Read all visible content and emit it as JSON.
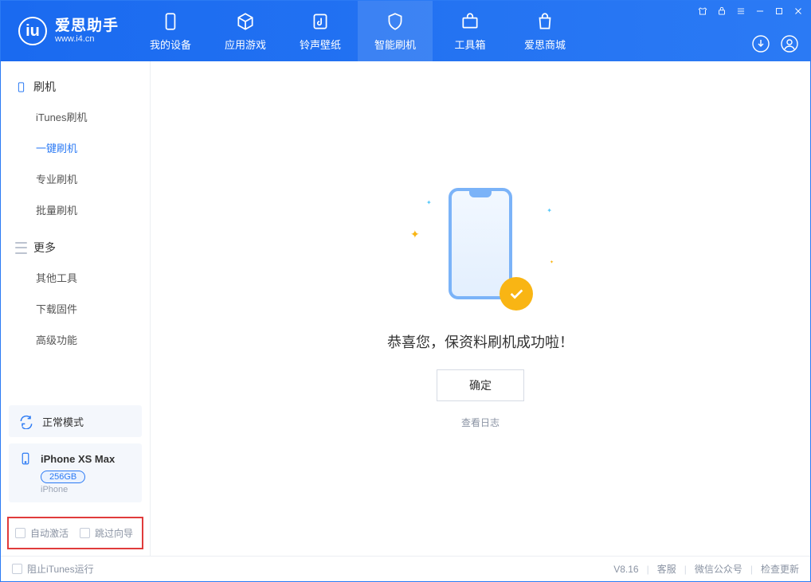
{
  "app": {
    "title": "爱思助手",
    "subtitle": "www.i4.cn"
  },
  "nav": {
    "items": [
      {
        "label": "我的设备"
      },
      {
        "label": "应用游戏"
      },
      {
        "label": "铃声壁纸"
      },
      {
        "label": "智能刷机"
      },
      {
        "label": "工具箱"
      },
      {
        "label": "爱思商城"
      }
    ]
  },
  "sidebar": {
    "group_flash": "刷机",
    "items_flash": [
      {
        "label": "iTunes刷机"
      },
      {
        "label": "一键刷机"
      },
      {
        "label": "专业刷机"
      },
      {
        "label": "批量刷机"
      }
    ],
    "group_more": "更多",
    "items_more": [
      {
        "label": "其他工具"
      },
      {
        "label": "下载固件"
      },
      {
        "label": "高级功能"
      }
    ]
  },
  "device": {
    "mode": "正常模式",
    "name": "iPhone XS Max",
    "storage": "256GB",
    "type": "iPhone"
  },
  "options": {
    "auto_activate": "自动激活",
    "skip_guide": "跳过向导"
  },
  "main": {
    "success_title": "恭喜您，保资料刷机成功啦！",
    "ok": "确定",
    "view_log": "查看日志"
  },
  "status": {
    "block_itunes": "阻止iTunes运行",
    "version": "V8.16",
    "links": [
      "客服",
      "微信公众号",
      "检查更新"
    ]
  }
}
